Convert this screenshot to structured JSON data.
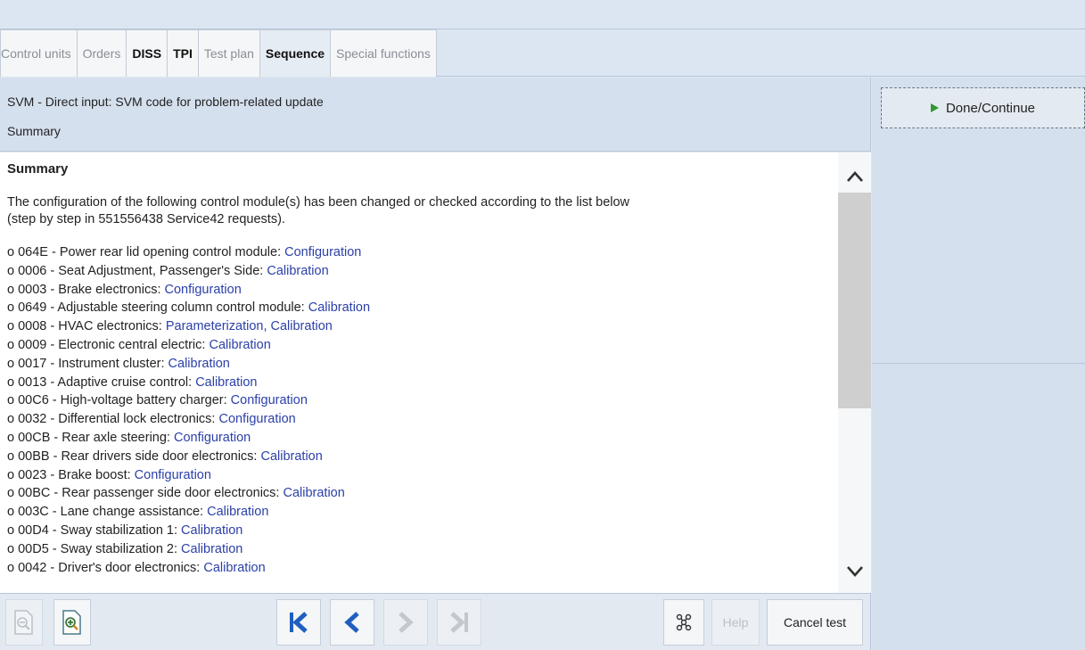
{
  "tabs": [
    {
      "label": "Control units",
      "style": "dim"
    },
    {
      "label": "Orders",
      "style": "dim"
    },
    {
      "label": "DISS",
      "style": "bold"
    },
    {
      "label": "TPI",
      "style": "bold"
    },
    {
      "label": "Test plan",
      "style": "dim"
    },
    {
      "label": "Sequence",
      "style": "active"
    },
    {
      "label": "Special functions",
      "style": "dim"
    }
  ],
  "header": {
    "title": "SVM - Direct input: SVM code for problem-related update",
    "subtitle": "Summary"
  },
  "content": {
    "heading": "Summary",
    "paragraph_line1": "The configuration of the following control module(s) has been changed or checked according to the list below",
    "paragraph_line2": "(step by step in 551556438 Service42 requests).",
    "items": [
      {
        "prefix": "o 064E - Power rear lid opening control module: ",
        "action": "Configuration"
      },
      {
        "prefix": "o 0006 - Seat Adjustment, Passenger's Side: ",
        "action": "Calibration"
      },
      {
        "prefix": "o 0003 - Brake electronics: ",
        "action": "Configuration"
      },
      {
        "prefix": "o 0649 - Adjustable steering column control module: ",
        "action": "Calibration"
      },
      {
        "prefix": "o 0008 - HVAC electronics: ",
        "action": "Parameterization, Calibration"
      },
      {
        "prefix": "o 0009 - Electronic central electric: ",
        "action": "Calibration"
      },
      {
        "prefix": "o 0017 - Instrument cluster: ",
        "action": "Calibration"
      },
      {
        "prefix": "o 0013 - Adaptive cruise control: ",
        "action": "Calibration"
      },
      {
        "prefix": "o 00C6 - High-voltage battery charger: ",
        "action": "Configuration"
      },
      {
        "prefix": "o 0032 - Differential lock electronics: ",
        "action": "Configuration"
      },
      {
        "prefix": "o 00CB - Rear axle steering: ",
        "action": "Configuration"
      },
      {
        "prefix": "o 00BB - Rear drivers side door electronics: ",
        "action": "Calibration"
      },
      {
        "prefix": "o 0023 - Brake boost: ",
        "action": "Configuration"
      },
      {
        "prefix": "o 00BC - Rear passenger side door electronics: ",
        "action": "Calibration"
      },
      {
        "prefix": "o 003C - Lane change assistance: ",
        "action": "Calibration"
      },
      {
        "prefix": "o 00D4 - Sway stabilization 1: ",
        "action": "Calibration"
      },
      {
        "prefix": "o 00D5 - Sway stabilization 2: ",
        "action": "Calibration"
      },
      {
        "prefix": "o 0042 - Driver's door electronics: ",
        "action": "Calibration"
      }
    ]
  },
  "toolbar": {
    "help_label": "Help",
    "cancel_label": "Cancel test"
  },
  "side": {
    "done_label": "Done/Continue"
  },
  "colors": {
    "link": "#2b3fa8",
    "nav_arrow": "#1f5fbf",
    "play_icon": "#2e9a2e"
  }
}
